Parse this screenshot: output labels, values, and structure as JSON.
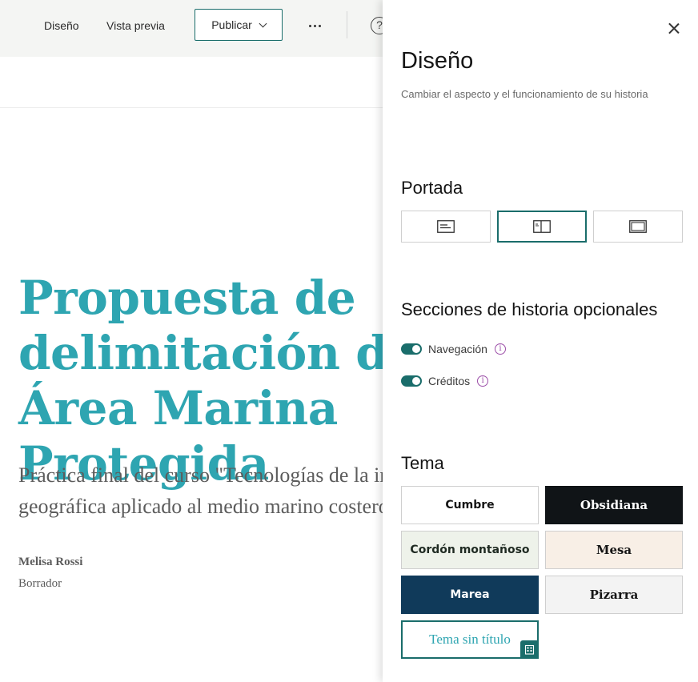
{
  "header": {
    "design_label": "Diseño",
    "preview_label": "Vista previa",
    "publish_label": "Publicar",
    "help_glyph": "?"
  },
  "story": {
    "title": "Propuesta de delimitación de un Área Marina Protegida",
    "subtitle": "Práctica final del curso \"Tecnologías de la información geográfica aplicado al medio marino costero\".",
    "author": "Melisa Rossi",
    "status": "Borrador"
  },
  "panel": {
    "title": "Diseño",
    "description": "Cambiar el aspecto y el funcionamiento de su historia",
    "cover_heading": "Portada",
    "cover_options": [
      {
        "icon": "cover-minimal-icon",
        "selected": false
      },
      {
        "icon": "cover-sidebyside-icon",
        "selected": true
      },
      {
        "icon": "cover-full-icon",
        "selected": false
      }
    ],
    "sections_heading": "Secciones de historia opcionales",
    "navigation_label": "Navegación",
    "credits_label": "Créditos",
    "info_glyph": "i",
    "theme_heading": "Tema",
    "themes": [
      {
        "label": "Cumbre",
        "bg": "#ffffff",
        "fg": "#151515",
        "serif": false
      },
      {
        "label": "Obsidiana",
        "bg": "#101417",
        "fg": "#ffffff",
        "serif": true
      },
      {
        "label": "Cordón montañoso",
        "bg": "#eef2ea",
        "fg": "#1f2a22",
        "serif": false
      },
      {
        "label": "Mesa",
        "bg": "#f8efe6",
        "fg": "#151515",
        "serif": true
      },
      {
        "label": "Marea",
        "bg": "#103a5a",
        "fg": "#ffffff",
        "serif": false
      },
      {
        "label": "Pizarra",
        "bg": "#f3f3f3",
        "fg": "#151515",
        "serif": true
      }
    ],
    "custom_theme_label": "Tema sin título"
  },
  "colors": {
    "accent": "#1a6d6b",
    "title_teal": "#2ea5b1",
    "info_purple": "#9c4fa8"
  }
}
